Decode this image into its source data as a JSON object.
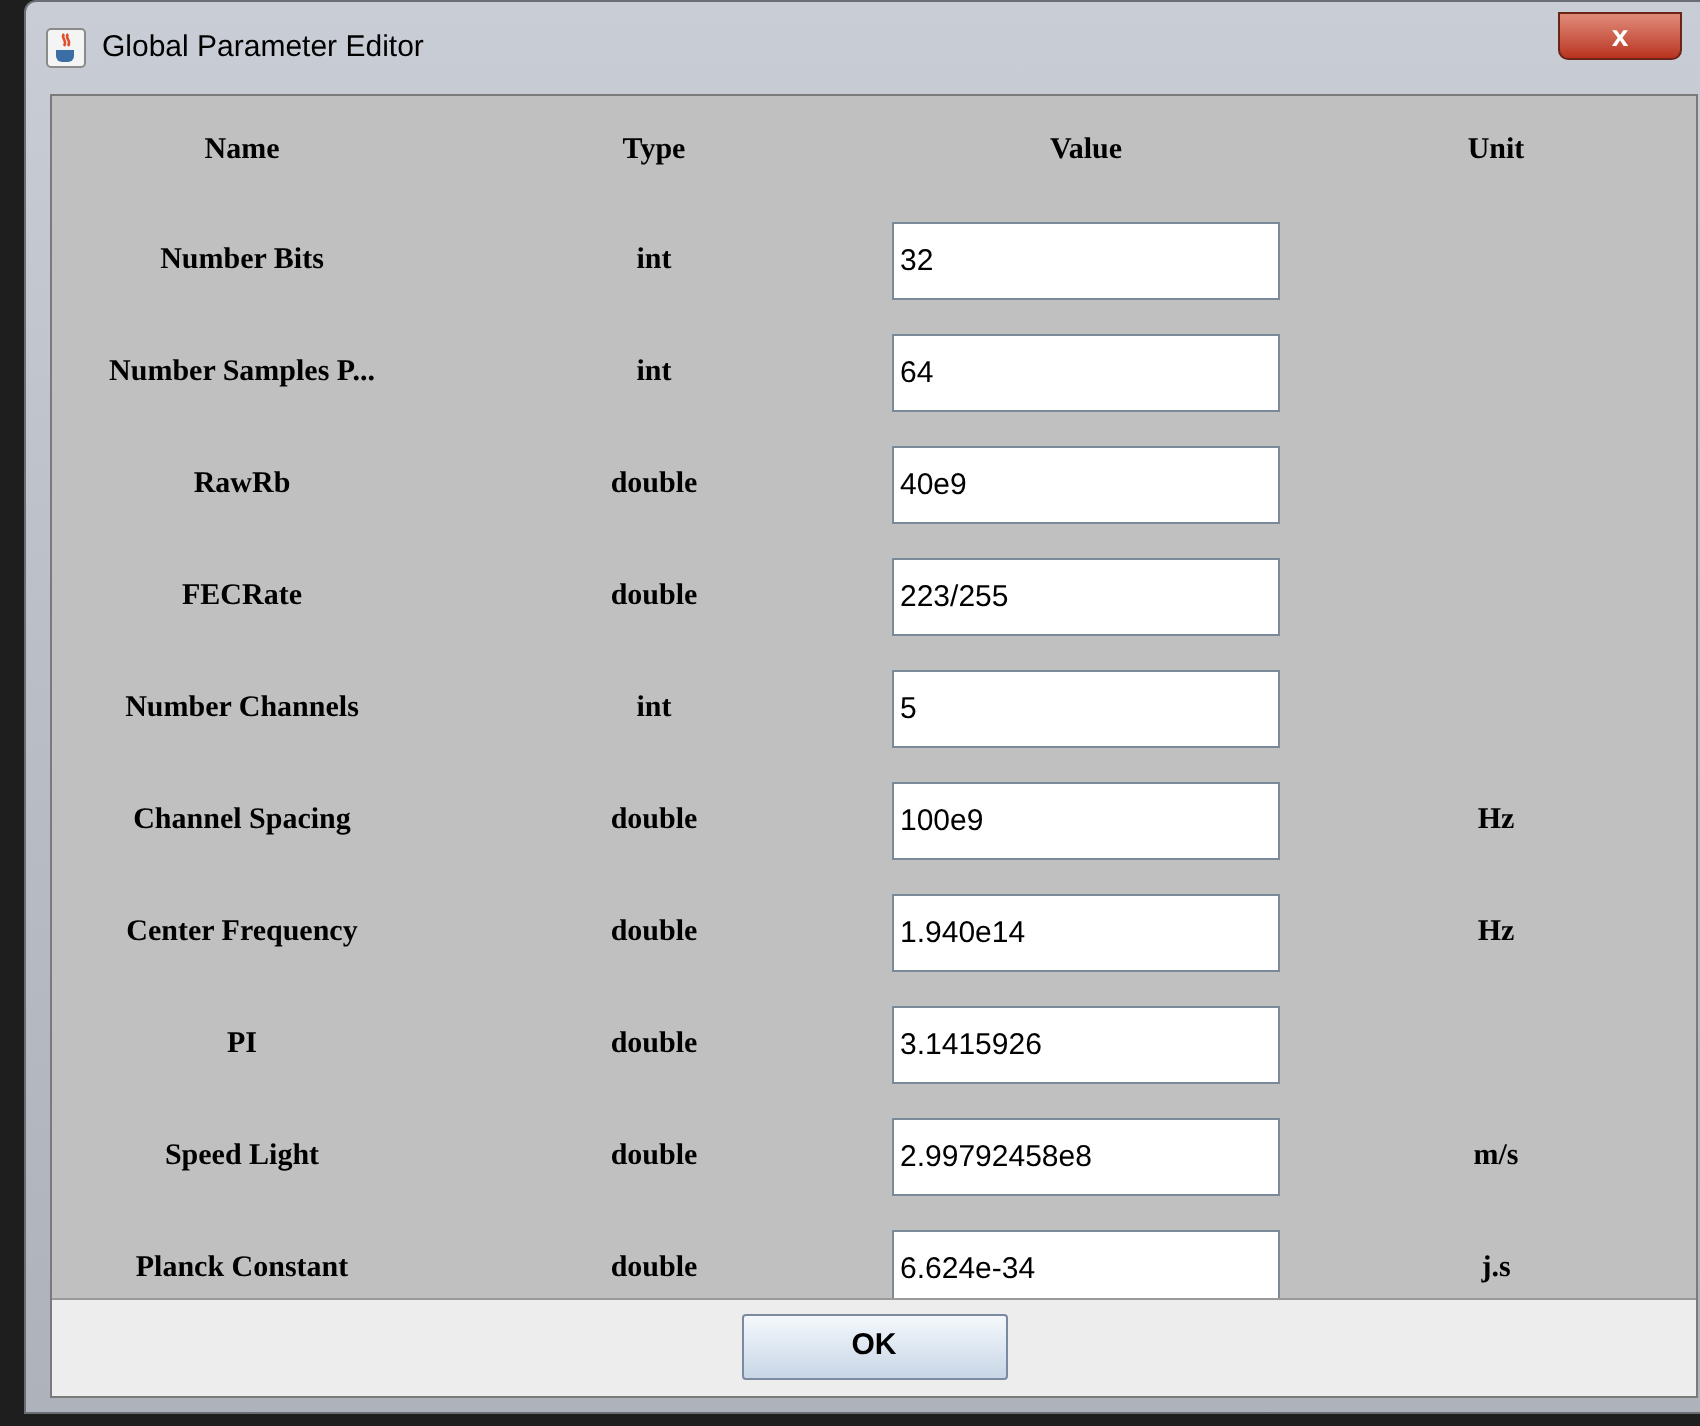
{
  "window": {
    "title": "Global Parameter Editor",
    "close": "x"
  },
  "table": {
    "columns": [
      "Name",
      "Type",
      "Value",
      "Unit"
    ],
    "rows": [
      {
        "name": "Number Bits",
        "type": "int",
        "value": "32"
      },
      {
        "name": "Number Samples P...",
        "type": "int",
        "value": "64"
      },
      {
        "name": "RawRb",
        "type": "double",
        "value": "40e9"
      },
      {
        "name": "FECRate",
        "type": "double",
        "value": "223/255"
      },
      {
        "name": "Number Channels",
        "type": "int",
        "value": "5"
      },
      {
        "name": "Channel Spacing",
        "type": "double",
        "value": "100e9",
        "unit": "Hz"
      },
      {
        "name": "Center Frequency",
        "type": "double",
        "value": "1.940e14",
        "unit": "Hz"
      },
      {
        "name": "PI",
        "type": "double",
        "value": "3.1415926"
      },
      {
        "name": "Speed Light",
        "type": "double",
        "value": "2.99792458e8",
        "unit": "m/s"
      },
      {
        "name": "Planck Constant",
        "type": "double",
        "value": "6.624e-34",
        "unit": "j.s"
      }
    ]
  },
  "buttons": [
    "OK"
  ]
}
